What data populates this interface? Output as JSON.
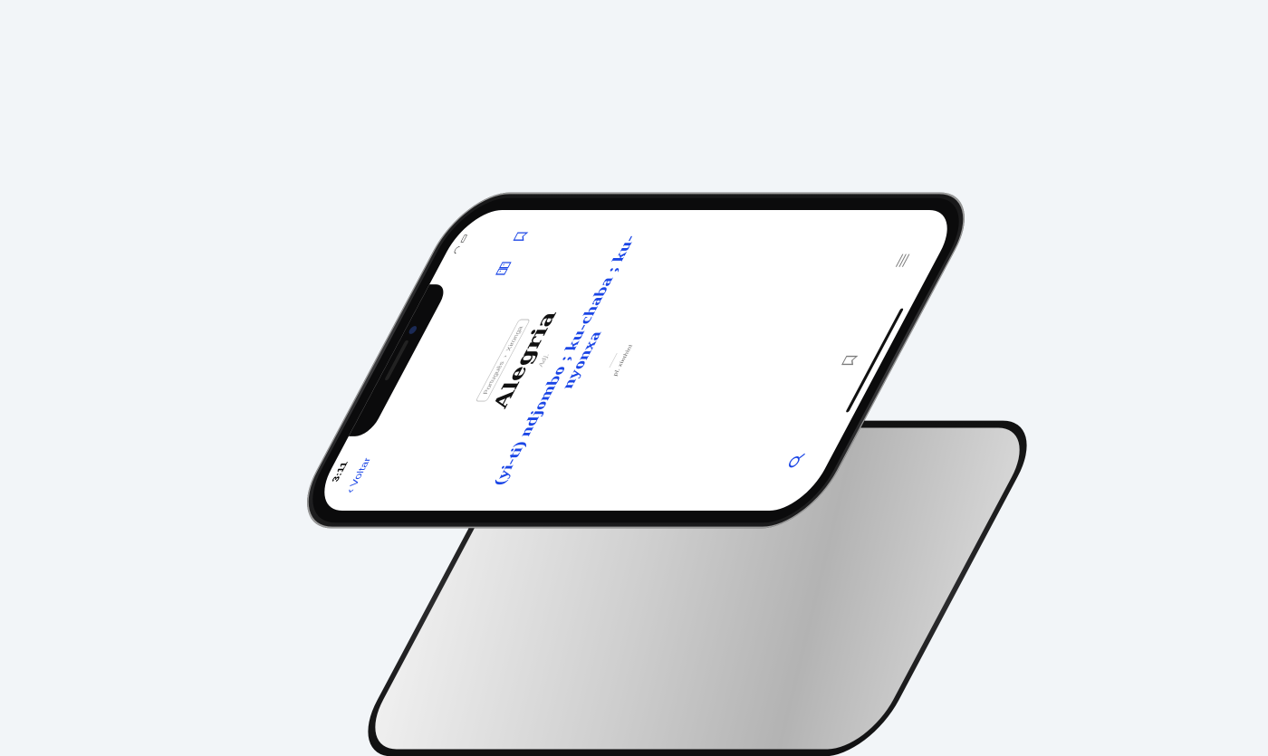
{
  "status_bar": {
    "time": "3:11"
  },
  "nav": {
    "back_label": "Voltar"
  },
  "entry": {
    "lang_from": "Português",
    "lang_separator": "›",
    "lang_to": "Xironga",
    "word": "Alegria",
    "word_class": "Adj.",
    "translation": "(yi-ti) ndjombo ; ku-chaba ; ku-nyonxa",
    "plural": "pl. xinthini"
  },
  "icons": {
    "nav": [
      "dictionary-book-icon",
      "bookmark-icon"
    ],
    "tabs": [
      "search-icon",
      "bookmark-icon",
      "menu-icon"
    ]
  },
  "colors": {
    "accent": "#1b46e6",
    "background": "#f2f5f8"
  }
}
